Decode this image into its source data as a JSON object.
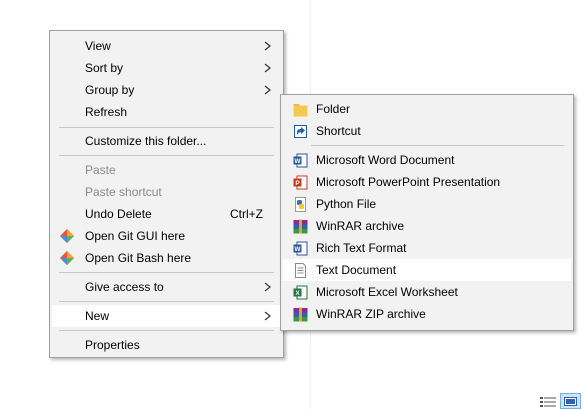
{
  "context_menu": {
    "items": [
      {
        "label": "View"
      },
      {
        "label": "Sort by"
      },
      {
        "label": "Group by"
      },
      {
        "label": "Refresh"
      },
      {
        "label": "Customize this folder..."
      },
      {
        "label": "Paste"
      },
      {
        "label": "Paste shortcut"
      },
      {
        "label": "Undo Delete",
        "shortcut": "Ctrl+Z"
      },
      {
        "label": "Open Git GUI here"
      },
      {
        "label": "Open Git Bash here"
      },
      {
        "label": "Give access to"
      },
      {
        "label": "New"
      },
      {
        "label": "Properties"
      }
    ]
  },
  "new_submenu": {
    "items": [
      {
        "label": "Folder",
        "icon": "folder-icon"
      },
      {
        "label": "Shortcut",
        "icon": "shortcut-icon"
      },
      {
        "label": "Microsoft Word Document",
        "icon": "word-document-icon"
      },
      {
        "label": "Microsoft PowerPoint Presentation",
        "icon": "powerpoint-icon"
      },
      {
        "label": "Python File",
        "icon": "python-file-icon"
      },
      {
        "label": "WinRAR archive",
        "icon": "winrar-icon"
      },
      {
        "label": "Rich Text Format",
        "icon": "rich-text-icon"
      },
      {
        "label": "Text Document",
        "icon": "text-document-icon"
      },
      {
        "label": "Microsoft Excel Worksheet",
        "icon": "excel-icon"
      },
      {
        "label": "WinRAR ZIP archive",
        "icon": "winrar-zip-icon"
      }
    ]
  },
  "colors": {
    "menu_bg": "#f2f2f2",
    "highlight": "#ffffff",
    "disabled_text": "#8a8a8a",
    "separator": "#c8c8c8"
  }
}
